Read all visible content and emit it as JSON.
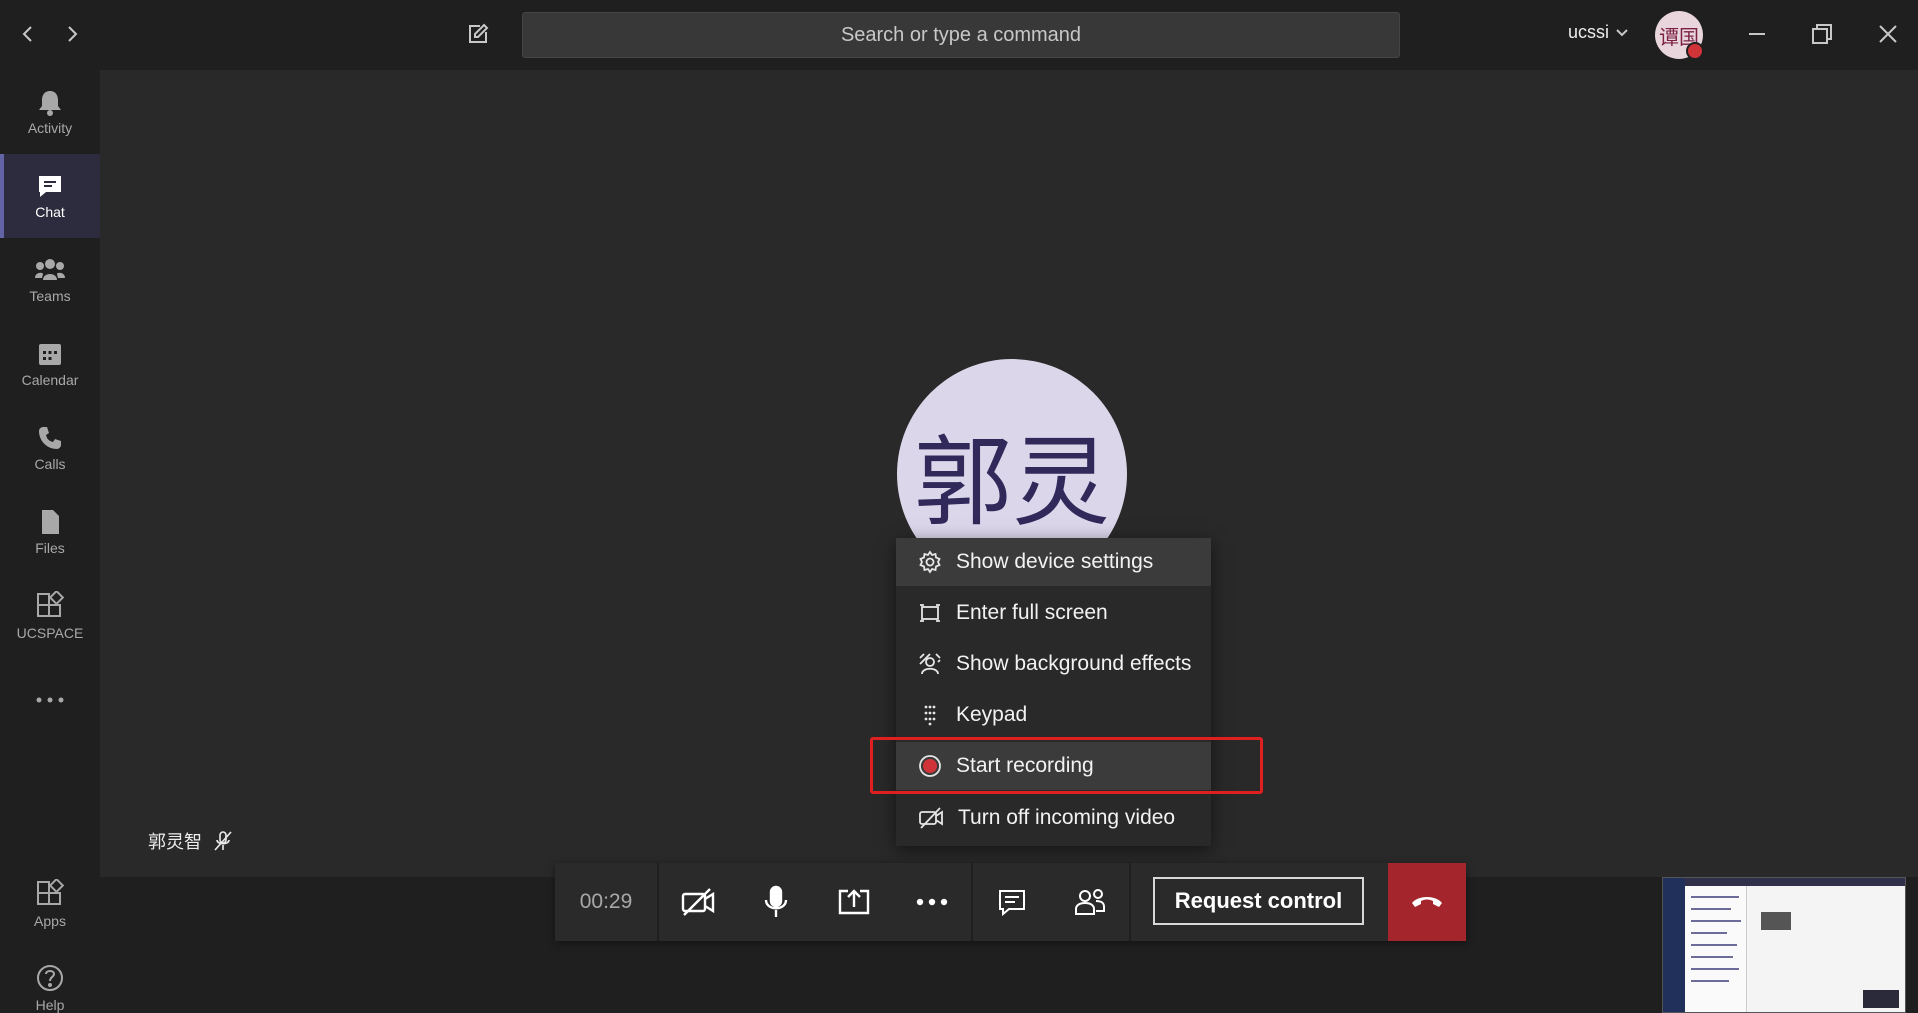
{
  "window": {
    "user_name": "ucssi",
    "avatar_initials": "谭国",
    "search_placeholder": "Search or type a command"
  },
  "rail": {
    "items": [
      {
        "label": "Activity",
        "icon": "bell-icon"
      },
      {
        "label": "Chat",
        "icon": "chat-icon",
        "active": true
      },
      {
        "label": "Teams",
        "icon": "teams-icon"
      },
      {
        "label": "Calendar",
        "icon": "calendar-icon"
      },
      {
        "label": "Calls",
        "icon": "phone-icon"
      },
      {
        "label": "Files",
        "icon": "file-icon"
      },
      {
        "label": "UCSPACE",
        "icon": "app-grid-icon"
      }
    ],
    "bottom_items": [
      {
        "label": "Apps",
        "icon": "apps-icon"
      },
      {
        "label": "Help",
        "icon": "help-icon"
      }
    ]
  },
  "call": {
    "participant_initials": "郭灵",
    "participant_name": "郭灵智",
    "timer": "00:29",
    "request_control_label": "Request control"
  },
  "menu": {
    "items": [
      {
        "label": "Show device settings",
        "icon": "gear-icon"
      },
      {
        "label": "Enter full screen",
        "icon": "fullscreen-icon"
      },
      {
        "label": "Show background effects",
        "icon": "background-effects-icon"
      },
      {
        "label": "Keypad",
        "icon": "keypad-icon"
      },
      {
        "label": "Start recording",
        "icon": "record-icon"
      },
      {
        "label": "Turn off incoming video",
        "icon": "video-off-icon"
      }
    ]
  },
  "colors": {
    "accent": "#6264a7",
    "hangup": "#a4262c",
    "record": "#d13438",
    "highlight_box": "#e02020"
  }
}
